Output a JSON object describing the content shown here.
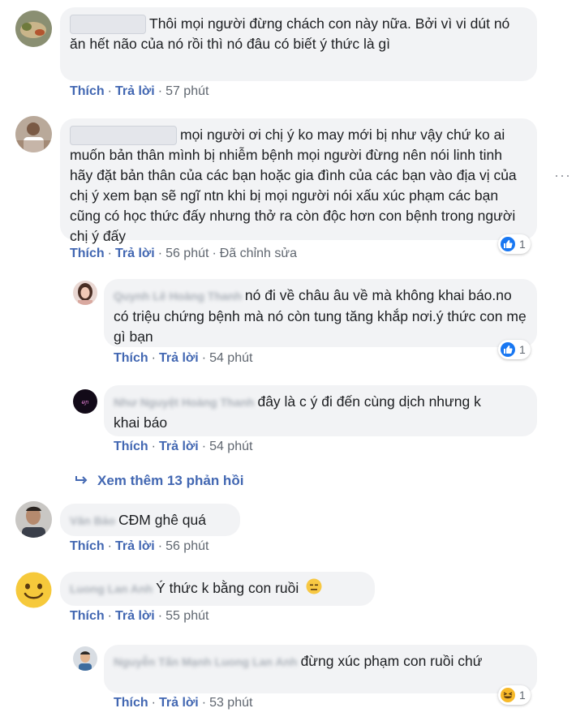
{
  "comments": [
    {
      "blurred_name": "",
      "text": "Thôi mọi người đừng chách con           này nữa. Bởi vì vi dút nó ăn hết não của nó rồi thì nó đâu có biết ý thức là gì",
      "like": "Thích",
      "reply": "Trả lời",
      "time": "57 phút"
    },
    {
      "blurred_name": "",
      "text": "mọi người ơi chị ý ko may mới bị như vậy chứ ko ai muốn bản thân mình bị nhiễm bệnh mọi người đừng nên nói linh tinh hãy đặt bản thân của các bạn hoặc gia đình của các bạn vào địa vị của chị ý xem bạn sẽ ngĩ ntn khi bị mọi người nói xấu xúc phạm các bạn cũng có học thức đấy nhưng thở ra còn độc hơn con bệnh trong người chị ý đấy",
      "like": "Thích",
      "reply": "Trả lời",
      "time": "56 phút",
      "edited": "Đã chỉnh sửa",
      "reaction_count": "1"
    },
    {
      "blurred_name": "Quynh Lê Hoàng Thanh",
      "text": "nó đi về châu âu về mà không khai báo.no có triệu chứng bệnh mà nó còn tung tăng khắp nơi.ý thức con mẹ gì bạn",
      "like": "Thích",
      "reply": "Trả lời",
      "time": "54 phút",
      "reaction_count": "1"
    },
    {
      "blurred_name": "Như Nguyệt Hoàng Thanh",
      "text": "đây là c ý đi đến cùng dịch nhưng k khai báo",
      "like": "Thích",
      "reply": "Trả lời",
      "time": "54 phút"
    },
    {
      "blurred_name": "Văn Bảo",
      "text": "CĐM ghê quá",
      "like": "Thích",
      "reply": "Trả lời",
      "time": "56 phút"
    },
    {
      "blurred_name": "Luong Lan Anh",
      "text": "Ý thức k bằng con ruồi",
      "like": "Thích",
      "reply": "Trả lời",
      "time": "55 phút"
    },
    {
      "blurred_name": "Nguyễn Tấn Mạnh Luong Lan Anh",
      "text": "đừng xúc phạm con ruồi chứ",
      "like": "Thích",
      "reply": "Trả lời",
      "time": "53 phút",
      "reaction_count": "1"
    }
  ],
  "view_more_replies": "Xem thêm 13 phản hồi",
  "colors": {
    "link": "#4267b2",
    "bubble": "#f2f3f5",
    "meta": "#606770",
    "like_blue": "#1877f2",
    "haha_yellow": "#f7b928"
  },
  "icons": {
    "like_reaction": "thumbs-up-icon",
    "haha_reaction": "laughing-face-icon",
    "reply_arrow": "reply-arrow-icon",
    "more": "more-horizontal-icon"
  }
}
